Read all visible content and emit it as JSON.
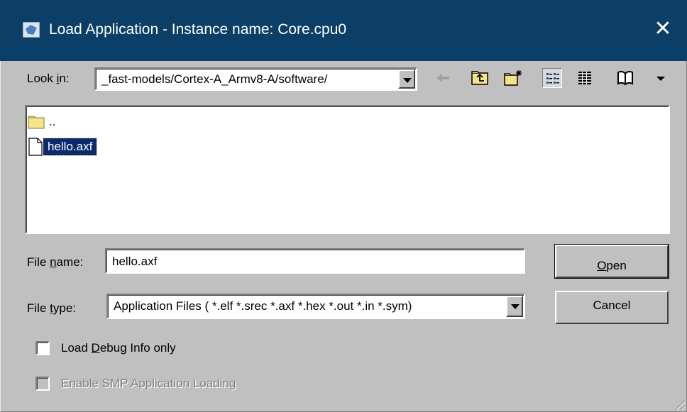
{
  "window": {
    "title": "Load Application - Instance name: Core.cpu0",
    "close_glyph": "✕"
  },
  "look_in": {
    "label_prefix": "Look ",
    "label_hotkey": "i",
    "label_suffix": "n:",
    "value": "_fast-models/Cortex-A_Armv8-A/software/"
  },
  "toolbar": {
    "buttons": [
      {
        "name": "back-icon",
        "pressed": false
      },
      {
        "name": "up-folder-icon",
        "pressed": false
      },
      {
        "name": "new-folder-icon",
        "pressed": false
      },
      {
        "name": "list-view-icon",
        "pressed": true
      },
      {
        "name": "details-view-icon",
        "pressed": false
      },
      {
        "name": "bookmarks-icon",
        "pressed": false
      },
      {
        "name": "dropdown-arrow-icon",
        "pressed": false
      }
    ]
  },
  "files": [
    {
      "name": "..",
      "type": "folder",
      "selected": false
    },
    {
      "name": "hello.axf",
      "type": "file",
      "selected": true
    }
  ],
  "file_name": {
    "label_prefix": "File ",
    "label_hotkey": "n",
    "label_suffix": "ame:",
    "value": "hello.axf"
  },
  "file_type": {
    "label_prefix": "File ",
    "label_hotkey": "t",
    "label_suffix": "ype:",
    "value": "Application Files ( *.elf *.srec *.axf *.hex *.out *.in *.sym)"
  },
  "buttons": {
    "open_hotkey": "O",
    "open_rest": "pen",
    "cancel": "Cancel"
  },
  "options": {
    "debug_prefix": "Load ",
    "debug_hotkey": "D",
    "debug_suffix": "ebug Info only",
    "debug_checked": false,
    "smp_label": "Enable SMP Application Loading",
    "smp_checked": false,
    "smp_enabled": false
  },
  "colors": {
    "titlebar": "#0b3f67",
    "dialog_bg": "#c0c0c0",
    "selection": "#0b2a6e"
  }
}
